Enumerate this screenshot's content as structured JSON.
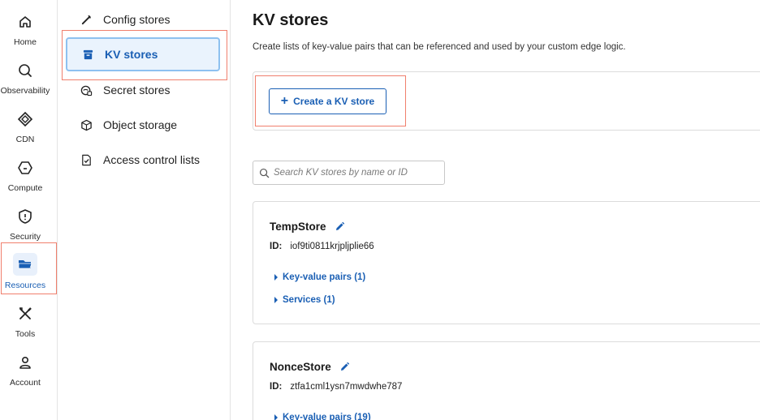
{
  "nav": {
    "items": [
      {
        "label": "Home",
        "icon": "home-icon"
      },
      {
        "label": "Observability",
        "icon": "observability-icon"
      },
      {
        "label": "CDN",
        "icon": "cdn-icon"
      },
      {
        "label": "Compute",
        "icon": "compute-icon"
      },
      {
        "label": "Security",
        "icon": "shield-icon"
      },
      {
        "label": "Resources",
        "icon": "folder-icon",
        "active": true
      },
      {
        "label": "Tools",
        "icon": "tools-icon"
      },
      {
        "label": "Account",
        "icon": "user-icon"
      }
    ]
  },
  "submenu": {
    "items": [
      {
        "label": "Config stores",
        "icon": "wrench-icon"
      },
      {
        "label": "KV stores",
        "icon": "kv-store-icon",
        "active": true
      },
      {
        "label": "Secret stores",
        "icon": "secret-icon"
      },
      {
        "label": "Object storage",
        "icon": "cube-icon"
      },
      {
        "label": "Access control lists",
        "icon": "checklist-icon"
      }
    ]
  },
  "main": {
    "title": "KV stores",
    "description": "Create lists of key-value pairs that can be referenced and used by your custom edge logic.",
    "create_button": "Create a KV store",
    "search_placeholder": "Search KV stores by name or ID",
    "id_label": "ID:",
    "stores": [
      {
        "name": "TempStore",
        "id": "iof9ti0811krjpljplie66",
        "kv_pairs": "Key-value pairs (1)",
        "services": "Services (1)"
      },
      {
        "name": "NonceStore",
        "id": "ztfa1cml1ysn7mwdwhe787",
        "kv_pairs": "Key-value pairs (19)"
      }
    ]
  },
  "colors": {
    "accent": "#1a5fb4",
    "highlight": "#f07f6d",
    "active_bg": "#eaf3fd"
  }
}
